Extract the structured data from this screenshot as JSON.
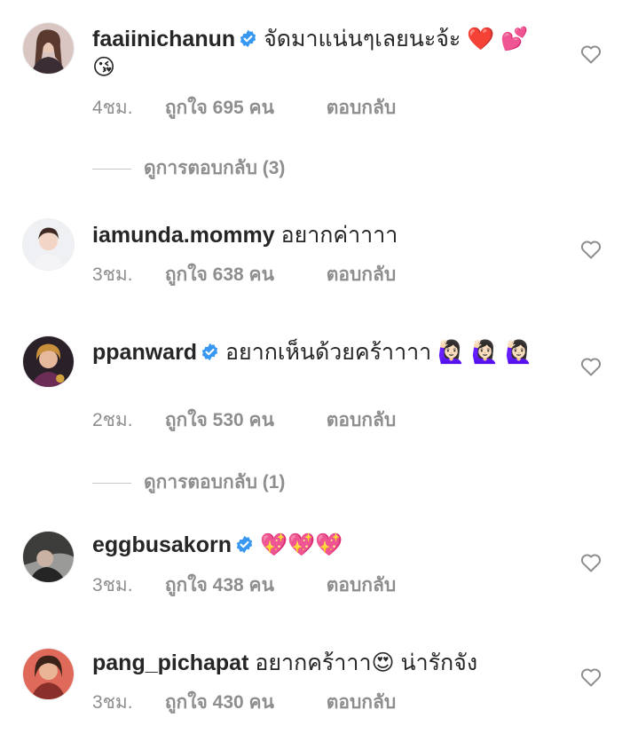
{
  "colors": {
    "text": "#262626",
    "meta": "#8e8e8e",
    "verified": "#3897f0",
    "background": "#ffffff"
  },
  "comments": [
    {
      "username": "faaiinichanun",
      "verified": true,
      "text": "จัดมาแน่นๆเลยนะจ้ะ ❤️ 💕 😘",
      "time": "4ชม.",
      "likes": "ถูกใจ 695 คน",
      "reply": "ตอบกลับ",
      "view_replies": "ดูการตอบกลับ (3)"
    },
    {
      "username": "iamunda.mommy",
      "verified": false,
      "text": "อยากค่าาาา",
      "time": "3ชม.",
      "likes": "ถูกใจ 638 คน",
      "reply": "ตอบกลับ"
    },
    {
      "username": "ppanward",
      "verified": true,
      "text": "อยากเห็นด้วยคร้าาาา 🙋🏻‍♀️ 🙋🏻‍♀️ 🙋🏻‍♀️",
      "time": "2ชม.",
      "likes": "ถูกใจ 530 คน",
      "reply": "ตอบกลับ",
      "view_replies": "ดูการตอบกลับ (1)"
    },
    {
      "username": "eggbusakorn",
      "verified": true,
      "text": "💖💖💖",
      "time": "3ชม.",
      "likes": "ถูกใจ 438 คน",
      "reply": "ตอบกลับ"
    },
    {
      "username": "pang_pichapat",
      "verified": false,
      "text": "อยากคร้าาา😍  น่ารักจัง",
      "time": "3ชม.",
      "likes": "ถูกใจ 430 คน",
      "reply": "ตอบกลับ"
    }
  ],
  "icons": {
    "like": "heart-outline-icon",
    "verified": "verified-badge-icon",
    "avatar": "profile-avatar"
  }
}
